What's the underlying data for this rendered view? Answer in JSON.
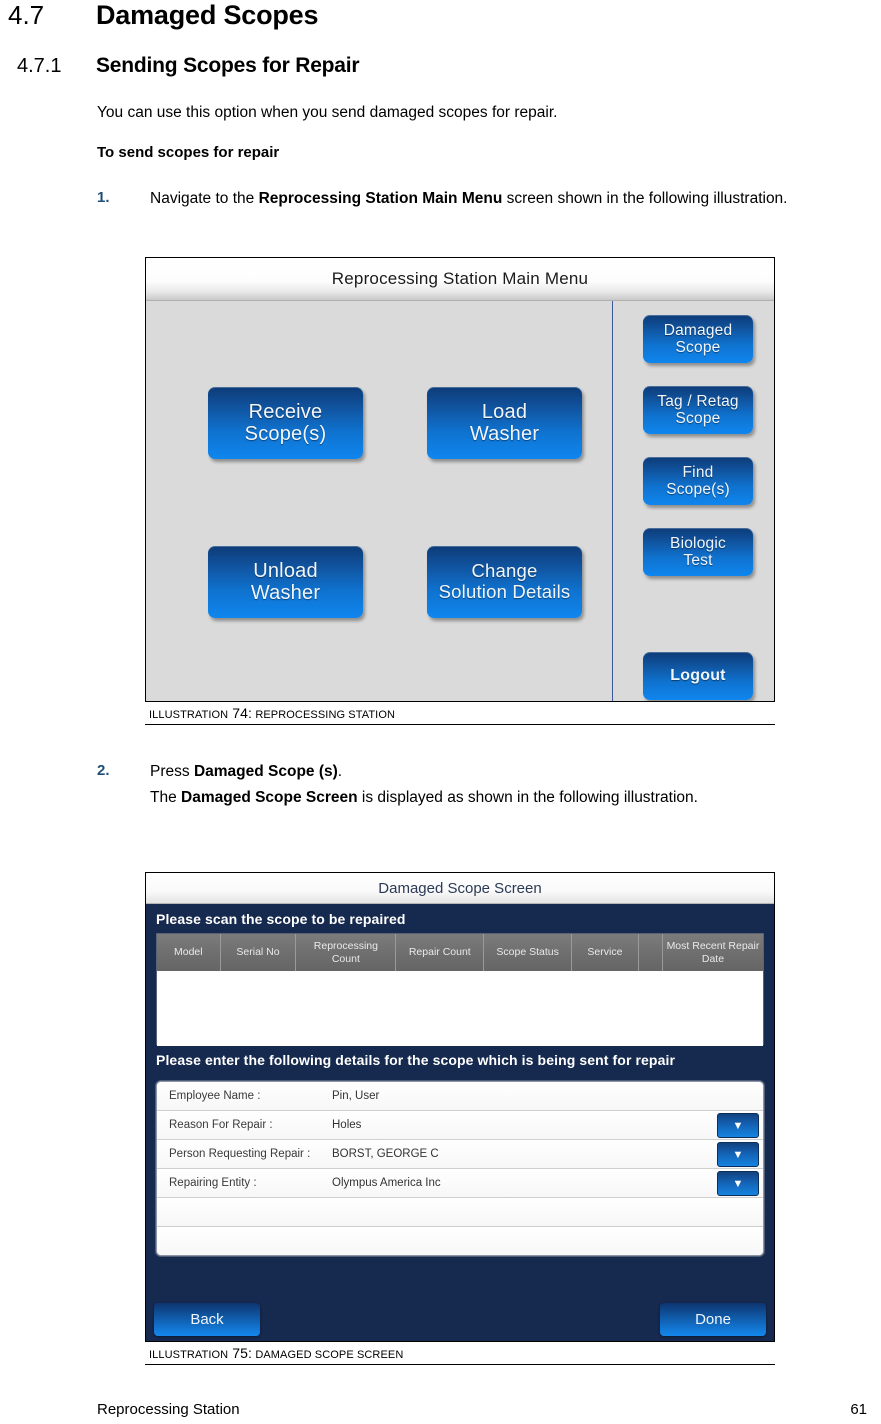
{
  "document": {
    "section": {
      "number": "4.7",
      "title": "Damaged Scopes"
    },
    "subsection": {
      "number": "4.7.1",
      "title": "Sending Scopes for Repair"
    },
    "intro": "You can use this option when you send damaged scopes for repair.",
    "lead_in": "To send scopes for repair",
    "steps": [
      {
        "number": "1.",
        "text_before": "Navigate to the ",
        "bold": "Reprocessing Station Main Menu",
        "text_after": " screen shown in the following illustration."
      },
      {
        "number": "2.",
        "line1_before": "Press ",
        "line1_bold": "Damaged Scope (s)",
        "line1_after": ".",
        "line2_before": "The ",
        "line2_bold": "Damaged Scope Screen",
        "line2_after": " is displayed as shown in the following illustration."
      }
    ],
    "footer": {
      "left": "Reprocessing Station",
      "page": "61"
    }
  },
  "illustration74": {
    "caption_prefix": "ILLUSTRATION",
    "caption_number": "74",
    "caption_sep": ":",
    "caption_text": "REPROCESSING STATION",
    "screen": {
      "title": "Reprocessing Station Main Menu",
      "main_buttons": [
        {
          "id": "receive",
          "label": "Receive\nScope(s)"
        },
        {
          "id": "load",
          "label": "Load\nWasher"
        },
        {
          "id": "unload",
          "label": "Unload\nWasher"
        },
        {
          "id": "change",
          "label": "Change\nSolution Details"
        }
      ],
      "side_buttons": [
        {
          "id": "damaged",
          "label": "Damaged\nScope"
        },
        {
          "id": "tag",
          "label": "Tag / Retag\nScope"
        },
        {
          "id": "find",
          "label": "Find\nScope(s)"
        },
        {
          "id": "biologic",
          "label": "Biologic\nTest"
        },
        {
          "id": "logout",
          "label": "Logout"
        }
      ]
    }
  },
  "illustration75": {
    "caption_prefix": "ILLUSTRATION",
    "caption_number": "75",
    "caption_sep": ":",
    "caption_text": "DAMAGED SCOPE SCREEN",
    "screen": {
      "title": "Damaged Scope Screen",
      "scan_prompt": "Please scan the scope to be repaired",
      "table": {
        "columns": [
          "Model",
          "Serial No",
          "Reprocessing Count",
          "Repair Count",
          "Scope Status",
          "Service",
          "",
          "Most Recent Repair Date"
        ],
        "rows": []
      },
      "details_prompt": "Please enter the following details for the scope which is being sent for repair",
      "fields": [
        {
          "label": "Employee Name :",
          "value": "Pin, User",
          "dropdown": false
        },
        {
          "label": "Reason For Repair :",
          "value": "Holes",
          "dropdown": true
        },
        {
          "label": "Person Requesting Repair :",
          "value": "BORST, GEORGE C",
          "dropdown": true
        },
        {
          "label": "Repairing Entity :",
          "value": "Olympus America Inc",
          "dropdown": true
        },
        {
          "label": "",
          "value": "",
          "dropdown": false
        },
        {
          "label": "",
          "value": "",
          "dropdown": false
        }
      ],
      "buttons": {
        "back": "Back",
        "done": "Done"
      },
      "dropdown_glyph": "▼"
    }
  },
  "colors": {
    "step_number": "#1F4E79",
    "screen_blue": "#16294e",
    "button_blue": "#1489ef",
    "panel_gray": "#dadada"
  }
}
